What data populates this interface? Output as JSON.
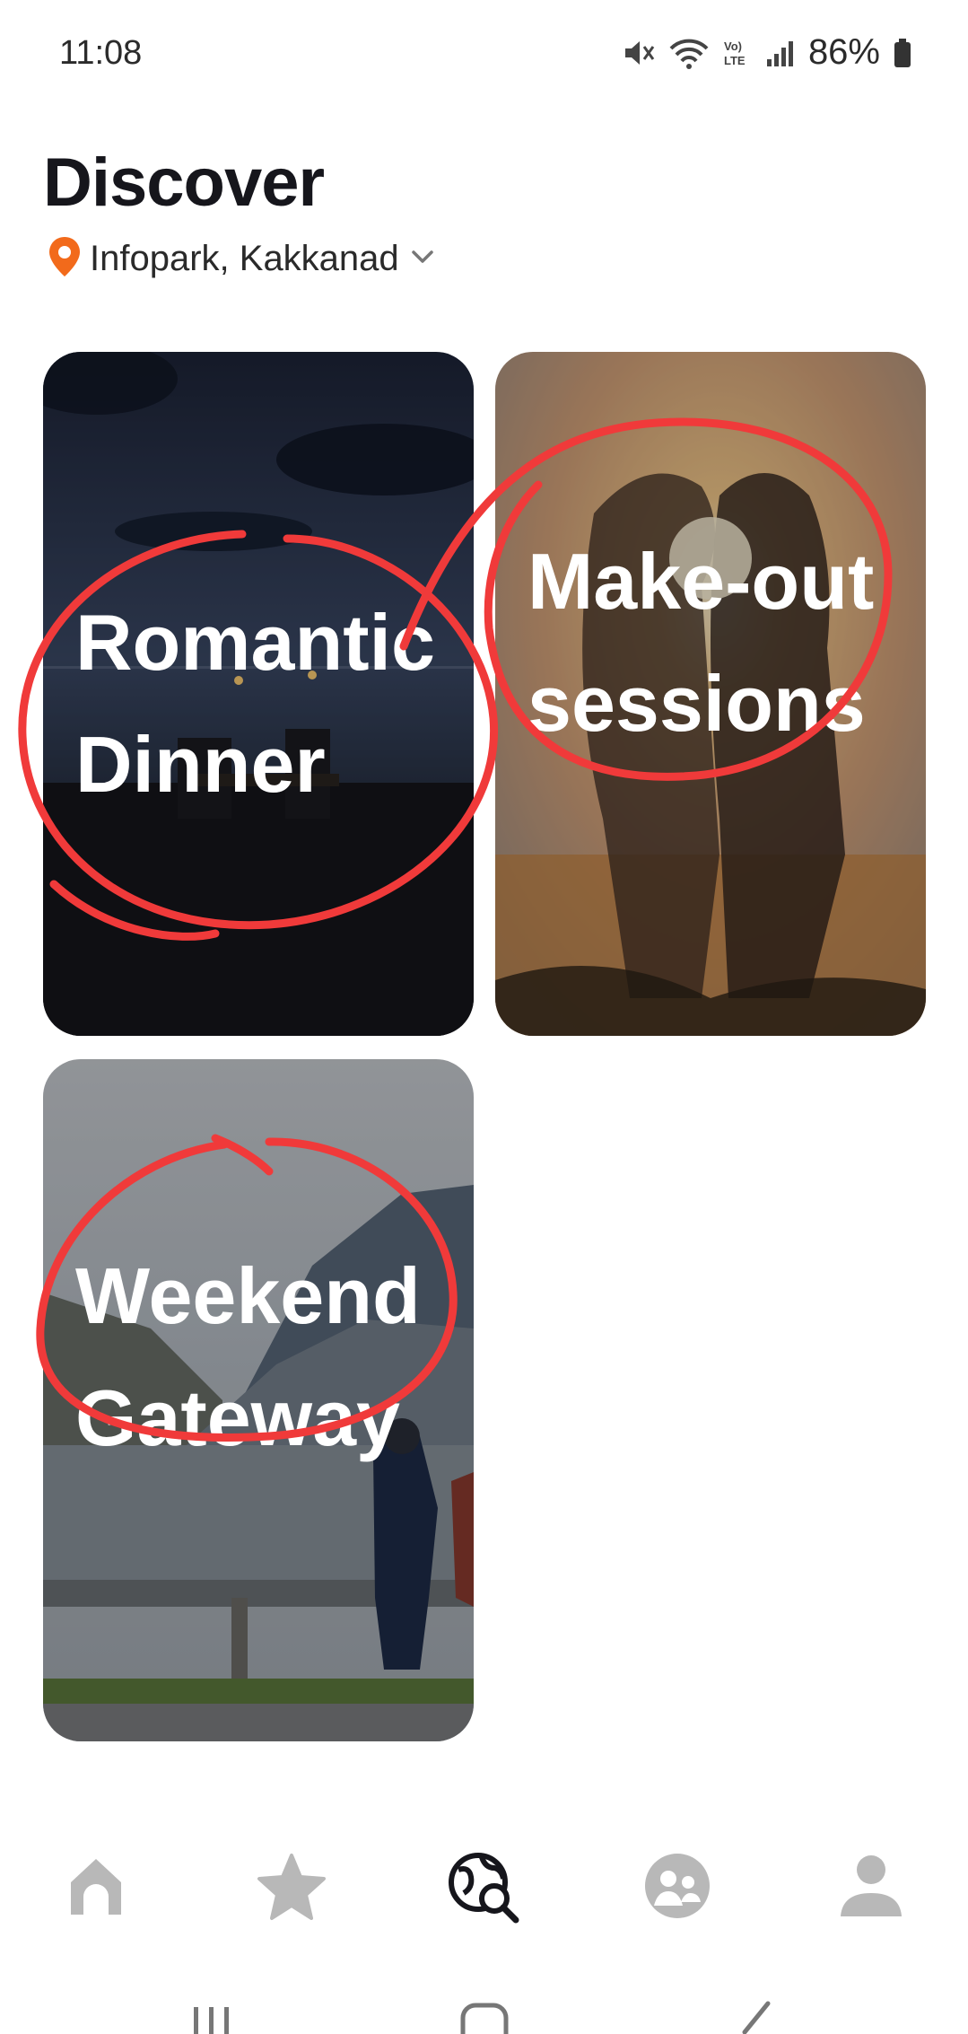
{
  "status_bar": {
    "time": "11:08",
    "battery_percent": "86%",
    "icons": [
      "mute-icon",
      "wifi-icon",
      "volte-icon",
      "signal-icon",
      "battery-icon"
    ]
  },
  "header": {
    "title": "Discover",
    "location": "Infopark, Kakkanad"
  },
  "cards": [
    {
      "title": "Romantic Dinner"
    },
    {
      "title": "Make-out sessions"
    },
    {
      "title": "Weekend Gateway"
    }
  ],
  "bottom_nav": {
    "items": [
      "home-icon",
      "star-icon",
      "discover-icon",
      "community-icon",
      "profile-icon"
    ],
    "active": "discover-icon"
  },
  "colors": {
    "accent": "#f26a1b",
    "annotation": "#f03a3a",
    "nav_inactive": "#b8b8b8",
    "nav_active": "#16161c"
  }
}
